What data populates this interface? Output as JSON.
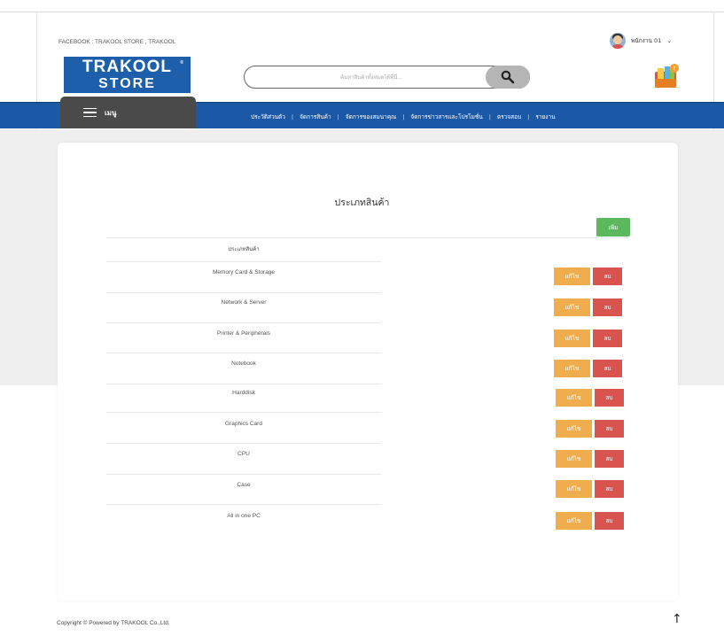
{
  "topbar": {
    "social_text": "FACEBOOK : TRAKOOL STORE , TRAKOOL",
    "user_name": "พนักงาน 01",
    "user_caret": "⌄"
  },
  "logo": {
    "line1": "TRAKOOL",
    "line2": "STORE",
    "registered": "®"
  },
  "search": {
    "placeholder": "ค้นหาสินค้าทั้งหมดได้ที่นี่..."
  },
  "menu": {
    "label": "เมนู"
  },
  "nav": {
    "items": [
      "ประวัติส่วนตัว",
      "จัดการสินค้า",
      "จัดการของสมนาคุณ",
      "จัดการข่าวสารและโปรโมชั่น",
      "ตรวจสอบ",
      "รายงาน"
    ],
    "separator": "|"
  },
  "main": {
    "title": "ประเภทสินค้า",
    "add_label": "เพิ่ม",
    "column_header": "ประเภทสินค้า",
    "rows": [
      "Memory Card & Storage",
      "Network & Server",
      "Printer & Peripherals",
      "Notebook",
      "Harddisk",
      "Graphics Card",
      "CPU",
      "Case",
      "All in one PC"
    ],
    "edit_label": "แก้ไข",
    "delete_label": "ลบ"
  },
  "footer": {
    "copyright": "Copyright © Powered by TRAKOOL Co.,Ltd.",
    "to_top_icon": "↑"
  },
  "colors": {
    "brand_blue": "#1b59a6",
    "add_green": "#5cb85c",
    "edit_orange": "#f0ad4e",
    "delete_red": "#d9534f"
  }
}
